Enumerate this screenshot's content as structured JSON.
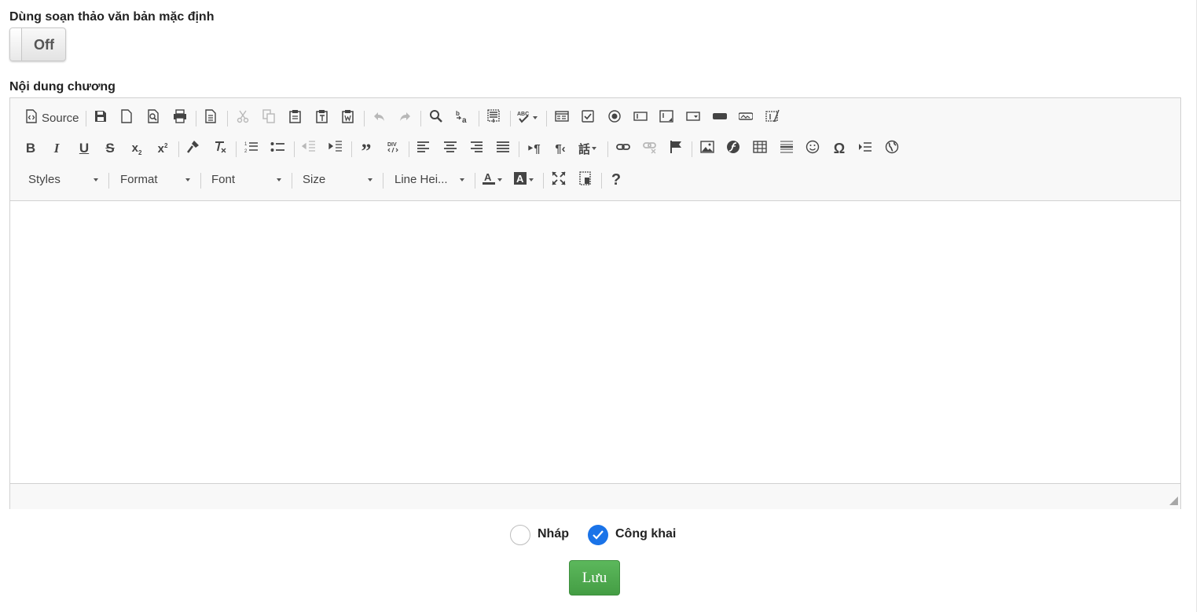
{
  "page": {
    "default_editor_label": "Dùng soạn thảo văn bản mặc định",
    "content_label": "Nội dung chương"
  },
  "toggle": {
    "state": "Off"
  },
  "editor": {
    "source_label": "Source",
    "combos": {
      "styles": "Styles",
      "format": "Format",
      "font": "Font",
      "size": "Size",
      "line_height": "Line Hei..."
    },
    "help": "?",
    "content": ""
  },
  "status": {
    "options": [
      {
        "label": "Nháp",
        "selected": false
      },
      {
        "label": "Công khai",
        "selected": true
      }
    ]
  },
  "actions": {
    "save_label": "Lưu"
  },
  "colors": {
    "accent": "#1a73e8",
    "save_green": "#4cae4c"
  },
  "icons": {
    "row1": [
      "source-icon",
      "save-icon",
      "new-page-icon",
      "preview-icon",
      "print-icon",
      "templates-icon",
      "cut-icon",
      "copy-icon",
      "paste-icon",
      "paste-text-icon",
      "paste-word-icon",
      "undo-icon",
      "redo-icon",
      "find-icon",
      "replace-icon",
      "select-all-icon",
      "spellcheck-icon",
      "form-icon",
      "checkbox-icon",
      "radio-icon",
      "textfield-icon",
      "textarea-icon",
      "select-icon",
      "button-icon",
      "image-button-icon",
      "hidden-field-icon"
    ],
    "row2": [
      "bold-icon",
      "italic-icon",
      "underline-icon",
      "strike-icon",
      "subscript-icon",
      "superscript-icon",
      "copy-format-icon",
      "remove-format-icon",
      "numbered-list-icon",
      "bulleted-list-icon",
      "outdent-icon",
      "indent-icon",
      "blockquote-icon",
      "div-icon",
      "align-left-icon",
      "align-center-icon",
      "align-right-icon",
      "justify-icon",
      "ltr-icon",
      "rtl-icon",
      "language-icon",
      "link-icon",
      "unlink-icon",
      "anchor-icon",
      "image-icon",
      "flash-icon",
      "table-icon",
      "horizontal-rule-icon",
      "smiley-icon",
      "special-char-icon",
      "page-break-icon",
      "iframe-icon"
    ],
    "row3": [
      "text-color-icon",
      "bg-color-icon",
      "maximize-icon",
      "show-blocks-icon",
      "help-icon"
    ]
  }
}
